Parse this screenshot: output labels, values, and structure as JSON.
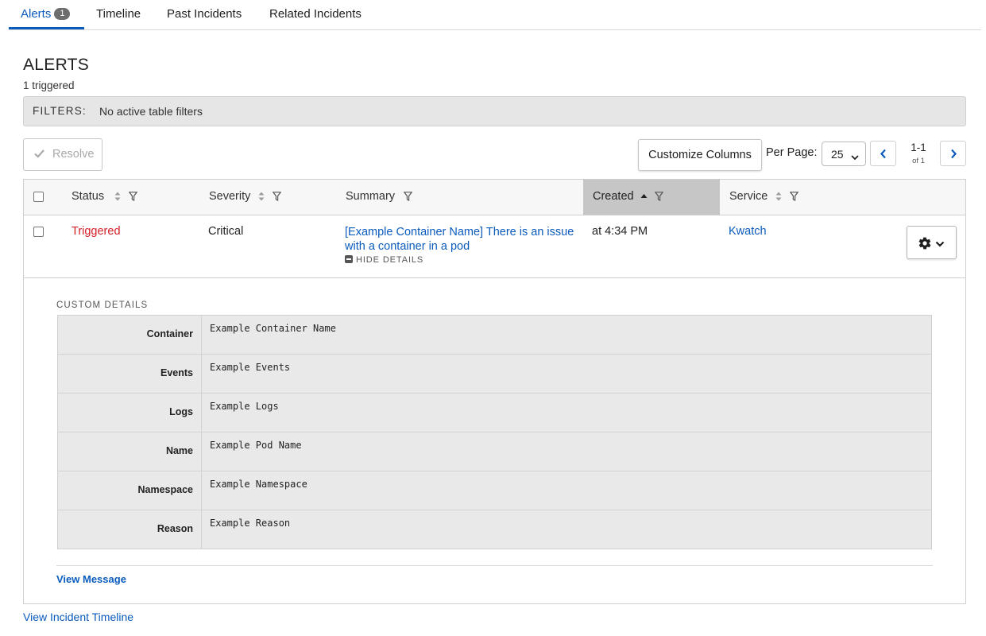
{
  "tabs": [
    {
      "label": "Alerts",
      "badge": "1",
      "active": true
    },
    {
      "label": "Timeline"
    },
    {
      "label": "Past Incidents"
    },
    {
      "label": "Related Incidents"
    }
  ],
  "alerts": {
    "title": "ALERTS",
    "triggered_count": "1 triggered",
    "filters_label": "FILTERS:",
    "filters_value": "No active table filters"
  },
  "toolbar": {
    "resolve_label": "Resolve",
    "customize_label": "Customize Columns",
    "per_page_label": "Per Page:",
    "per_page_value": "25",
    "page_range": "1-1",
    "page_of": "of 1"
  },
  "table": {
    "columns": [
      "Status",
      "Severity",
      "Summary",
      "Created",
      "Service"
    ],
    "sorted_column": "Created",
    "rows": [
      {
        "status": "Triggered",
        "severity": "Critical",
        "summary": "[Example Container Name] There is an issue with a container in a pod",
        "hide_details": "HIDE DETAILS",
        "created": "at 4:34 PM",
        "service": "Kwatch"
      }
    ]
  },
  "details": {
    "label": "CUSTOM DETAILS",
    "rows": [
      {
        "key": "Container",
        "value": "Example Container Name"
      },
      {
        "key": "Events",
        "value": "Example Events"
      },
      {
        "key": "Logs",
        "value": "Example Logs"
      },
      {
        "key": "Name",
        "value": "Example Pod Name"
      },
      {
        "key": "Namespace",
        "value": "Example Namespace"
      },
      {
        "key": "Reason",
        "value": "Example Reason"
      }
    ],
    "view_message": "View Message"
  },
  "footer": {
    "view_timeline": "View Incident Timeline"
  },
  "colors": {
    "accent": "#0a5bbd",
    "triggered": "#d51f26"
  }
}
